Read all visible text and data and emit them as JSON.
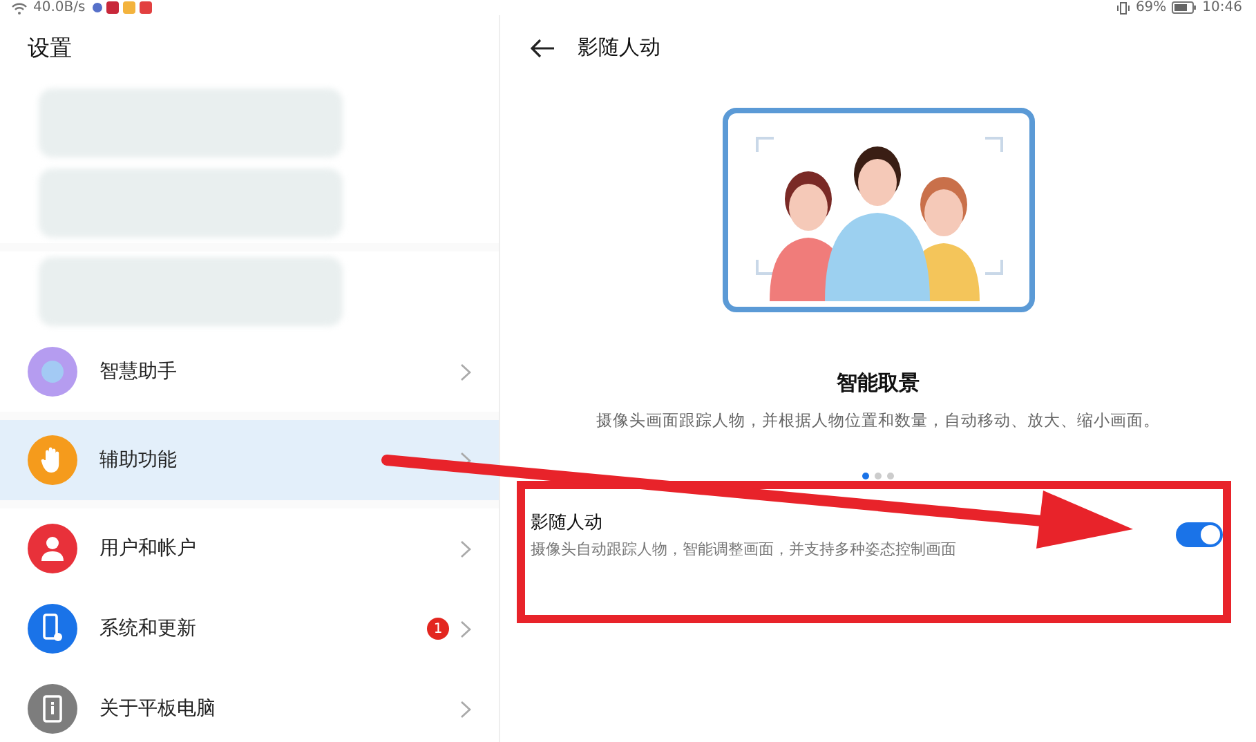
{
  "status_bar": {
    "network_speed": "40.0B/s",
    "battery": "69%",
    "time": "10:46"
  },
  "sidebar": {
    "title": "设置",
    "groups": [
      {
        "items": [
          {
            "kind": "redacted",
            "selected": false
          },
          {
            "kind": "redacted",
            "selected": false
          }
        ]
      },
      {
        "items": [
          {
            "kind": "redacted",
            "selected": false
          },
          {
            "kind": "item",
            "label": "智慧助手",
            "color": "#b59cf0",
            "selected": false
          }
        ]
      },
      {
        "items": [
          {
            "kind": "item",
            "label": "辅助功能",
            "color": "#f59b1c",
            "selected": true
          }
        ]
      },
      {
        "items": [
          {
            "kind": "item",
            "label": "用户和帐户",
            "color": "#e8313a",
            "selected": false
          },
          {
            "kind": "item",
            "label": "系统和更新",
            "color": "#1a73e8",
            "badge": "1",
            "selected": false
          },
          {
            "kind": "item",
            "label": "关于平板电脑",
            "color": "#7d7d7d",
            "selected": false
          }
        ]
      }
    ]
  },
  "detail": {
    "title": "影随人动",
    "feature_title": "智能取景",
    "feature_description": "摄像头画面跟踪人物，并根据人物位置和数量，自动移动、放大、缩小画面。",
    "page_dots": [
      {
        "selected": true
      },
      {
        "selected": false
      },
      {
        "selected": false
      }
    ],
    "setting": {
      "label": "影随人动",
      "description": "摄像头自动跟踪人物，智能调整画面，并支持多种姿态控制画面",
      "on": true
    }
  }
}
